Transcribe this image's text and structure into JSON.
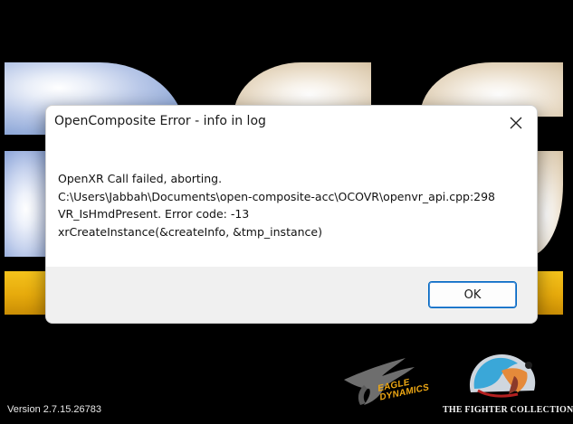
{
  "dialog": {
    "title": "OpenComposite Error - info in log",
    "message_lines": [
      "OpenXR Call failed, aborting.",
      "C:\\Users\\Jabbah\\Documents\\open-composite-acc\\OCOVR\\openvr_api.cpp:298",
      "VR_IsHmdPresent. Error code: -13",
      "xrCreateInstance(&createInfo, &tmp_instance)"
    ],
    "ok_label": "OK",
    "close_icon": "close-icon"
  },
  "splash": {
    "version": "Version 2.7.15.26783",
    "eagle_dynamics": [
      "EAGLE",
      "DYNAMICS"
    ],
    "fighter_collection": "THE FIGHTER COLLECTION",
    "colors": {
      "background": "#000000",
      "gold": "#f4c21b",
      "sky": "#8ea8d8"
    }
  }
}
